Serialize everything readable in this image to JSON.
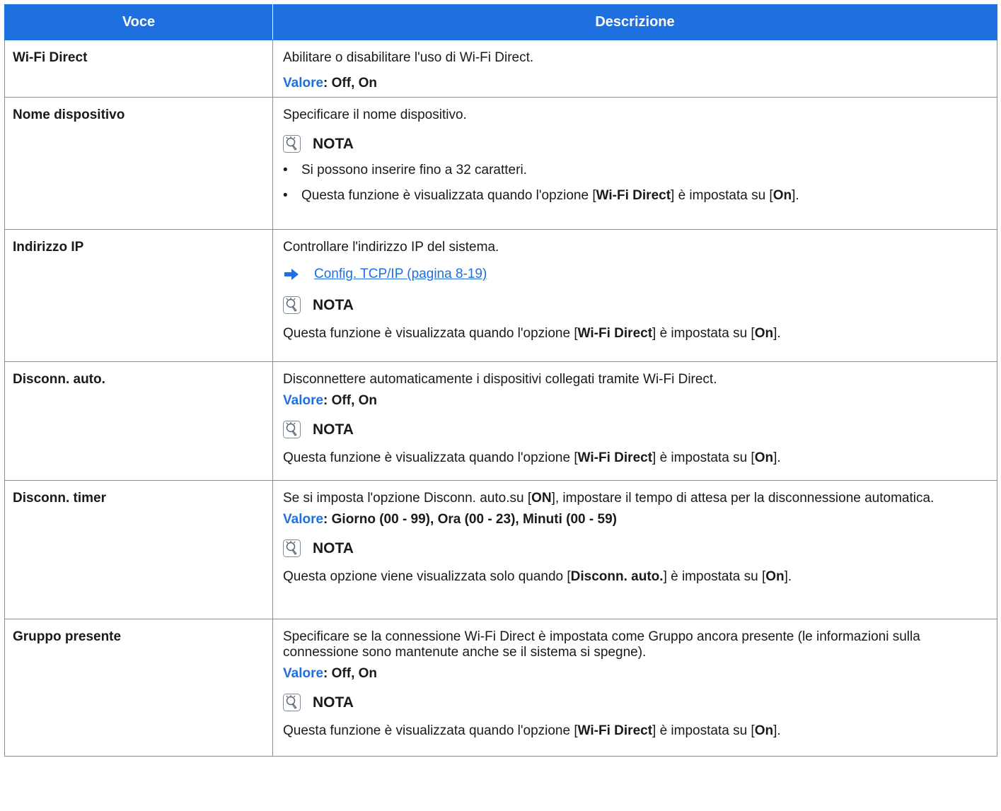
{
  "header": {
    "col_item": "Voce",
    "col_desc": "Descrizione"
  },
  "rows": [
    {
      "item": "Wi-Fi Direct",
      "desc": "Abilitare o disabilitare l'uso di Wi-Fi Direct.",
      "valore_label": "Valore",
      "valore_sep": ":",
      "valore_text": " Off, On"
    },
    {
      "item": "Nome dispositivo",
      "desc": "Specificare il nome dispositivo.",
      "nota_label": "NOTA",
      "bullets": [
        "Si possono inserire fino a 32 caratteri."
      ],
      "bullet2": {
        "a": "Questa funzione è visualizzata quando l'opzione [",
        "b": "Wi-Fi Direct",
        "c": "] è impostata su [",
        "d": "On",
        "e": "]."
      }
    },
    {
      "item": "Indirizzo IP",
      "desc": "Controllare l'indirizzo IP del sistema.",
      "link": "Config. TCP/IP (pagina 8-19)",
      "nota_label": "NOTA",
      "note": {
        "a": "Questa funzione è visualizzata quando l'opzione [",
        "b": "Wi-Fi Direct",
        "c": "] è impostata su [",
        "d": "On",
        "e": "]."
      }
    },
    {
      "item": "Disconn. auto.",
      "desc": "Disconnettere automaticamente i dispositivi collegati tramite Wi-Fi Direct.",
      "valore_label": "Valore",
      "valore_sep": ":",
      "valore_text": " Off, On",
      "nota_label": "NOTA",
      "note": {
        "a": "Questa funzione è visualizzata quando l'opzione [",
        "b": "Wi-Fi Direct",
        "c": "] è impostata su [",
        "d": "On",
        "e": "]."
      }
    },
    {
      "item": "Disconn. timer",
      "desc": {
        "a": "Se si imposta l'opzione Disconn. auto.su [",
        "b": "ON",
        "c": "], impostare il tempo di attesa per la disconnessione automatica."
      },
      "valore_label": "Valore",
      "valore_sep": ":",
      "valore_text": " Giorno (00 - 99), Ora (00 - 23), Minuti (00 - 59)",
      "nota_label": "NOTA",
      "note": {
        "a": "Questa opzione viene visualizzata solo quando [",
        "b": "Disconn. auto.",
        "c": "] è impostata su [",
        "d": "On",
        "e": "]."
      }
    },
    {
      "item": "Gruppo presente",
      "desc": "Specificare se la connessione Wi-Fi Direct è impostata come Gruppo ancora presente (le informazioni sulla connessione sono mantenute anche se il sistema si spegne).",
      "valore_label": "Valore",
      "valore_sep": ":",
      "valore_text": " Off, On",
      "nota_label": "NOTA",
      "note": {
        "a": "Questa funzione è visualizzata quando l'opzione [",
        "b": "Wi-Fi Direct",
        "c": "] è impostata su [",
        "d": "On",
        "e": "]."
      }
    }
  ],
  "colors": {
    "accent": "#1e6fe0",
    "border": "#8c8c8c"
  },
  "icons": {
    "note": "lightbulb-note-icon",
    "arrow": "arrow-right-icon"
  }
}
